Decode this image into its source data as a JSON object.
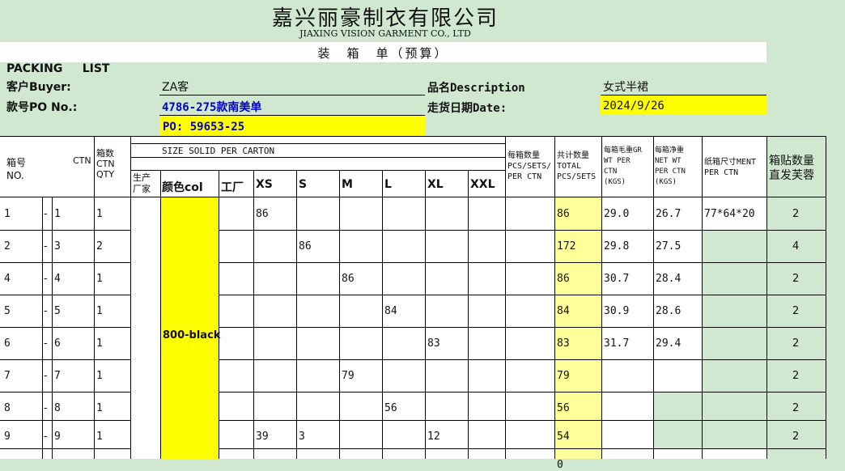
{
  "company": {
    "name_cn": "嘉兴丽豪制衣有限公司",
    "name_en": "JIAXING VISION GARMENT CO., LTD",
    "doc_title": "装　箱　单（预算）"
  },
  "packing_list_label": "PACKING     LIST",
  "info": {
    "buyer_label": "客户Buyer:",
    "buyer_value": "ZA客",
    "desc_label": "品名Description",
    "desc_value": "女式半裙",
    "po_label": "款号PO No.:",
    "po_value": "4786-275款南美单",
    "date_label": "走货日期Date:",
    "date_value": "2024/9/26",
    "po2_value": "PO: 59653-25"
  },
  "headers": {
    "box_no": "箱号\nNO.",
    "ctn": "CTN",
    "ctn_qty": "箱数\nCTN\nQTY",
    "size_solid": "SIZE SOLID PER CARTON",
    "factory_col": "生产厂家",
    "color": "颜色col",
    "factory": "工厂",
    "sizes": [
      "XS",
      "S",
      "M",
      "L",
      "XL",
      "XXL"
    ],
    "per_ctn": "每箱数量\nPCS/SETS/\nPER CTN",
    "total": "共计数量\nTOTAL\nPCS/SETS",
    "gross": "每箱毛重GR\nWT PER\nCTN\n(KGS)",
    "net": "每箱净重\nNET WT\nPER CTN\n(KGS)",
    "dims": "纸箱尺寸MENT\nPER CTN",
    "direct": "箱贴数量\n直发芙蓉"
  },
  "color_value": "800-black",
  "rows": [
    {
      "from": "1",
      "dash": "-",
      "to": "1",
      "qty": "1",
      "xs": "86",
      "s": "",
      "m": "",
      "l": "",
      "xl": "",
      "xxl": "",
      "total": "86",
      "gross": "29.0",
      "net": "26.7",
      "dims": "77*64*20",
      "direct": "2"
    },
    {
      "from": "2",
      "dash": "-",
      "to": "3",
      "qty": "2",
      "xs": "",
      "s": "86",
      "m": "",
      "l": "",
      "xl": "",
      "xxl": "",
      "total": "172",
      "gross": "29.8",
      "net": "27.5",
      "dims": "",
      "direct": "4"
    },
    {
      "from": "4",
      "dash": "-",
      "to": "4",
      "qty": "1",
      "xs": "",
      "s": "",
      "m": "86",
      "l": "",
      "xl": "",
      "xxl": "",
      "total": "86",
      "gross": "30.7",
      "net": "28.4",
      "dims": "",
      "direct": "2"
    },
    {
      "from": "5",
      "dash": "-",
      "to": "5",
      "qty": "1",
      "xs": "",
      "s": "",
      "m": "",
      "l": "84",
      "xl": "",
      "xxl": "",
      "total": "84",
      "gross": "30.9",
      "net": "28.6",
      "dims": "",
      "direct": "2"
    },
    {
      "from": "6",
      "dash": "-",
      "to": "6",
      "qty": "1",
      "xs": "",
      "s": "",
      "m": "",
      "l": "",
      "xl": "83",
      "xxl": "",
      "total": "83",
      "gross": "31.7",
      "net": "29.4",
      "dims": "",
      "direct": "2"
    },
    {
      "from": "7",
      "dash": "-",
      "to": "7",
      "qty": "1",
      "xs": "",
      "s": "",
      "m": "79",
      "l": "",
      "xl": "",
      "xxl": "",
      "total": "79",
      "gross": "",
      "net": "",
      "dims": "",
      "direct": "2"
    },
    {
      "from": "8",
      "dash": "-",
      "to": "8",
      "qty": "1",
      "xs": "",
      "s": "",
      "m": "",
      "l": "56",
      "xl": "",
      "xxl": "",
      "total": "56",
      "gross": "",
      "net": "",
      "dims": "",
      "direct": "2"
    },
    {
      "from": "9",
      "dash": "-",
      "to": "9",
      "qty": "1",
      "xs": "39",
      "s": "3",
      "m": "",
      "l": "",
      "xl": "12",
      "xxl": "",
      "total": "54",
      "gross": "",
      "net": "",
      "dims": "",
      "direct": "2"
    },
    {
      "from": "",
      "dash": "",
      "to": "",
      "qty": "",
      "xs": "",
      "s": "",
      "m": "",
      "l": "",
      "xl": "",
      "xxl": "",
      "total": "0",
      "gross": "",
      "net": "",
      "dims": "",
      "direct": ""
    }
  ]
}
